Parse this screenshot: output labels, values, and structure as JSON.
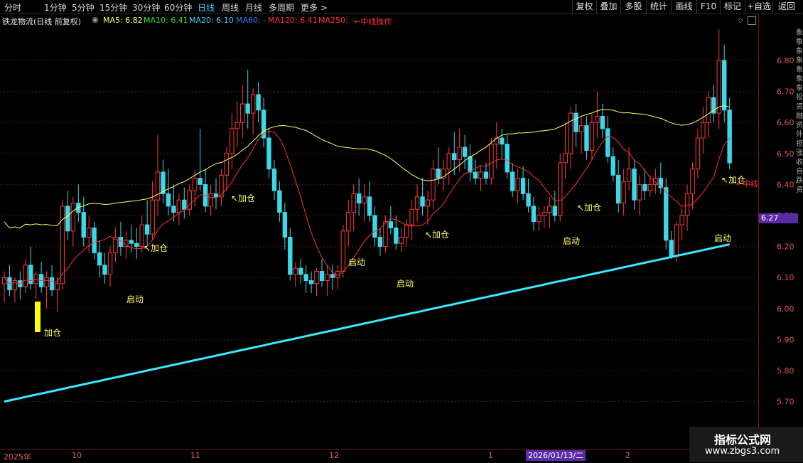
{
  "toolbar": {
    "periods": [
      "分时",
      "1分钟",
      "5分钟",
      "15分钟",
      "30分钟",
      "60分钟",
      "日线",
      "周线",
      "月线",
      "多周期",
      "更多 >"
    ],
    "active_period": "日线",
    "right_buttons": [
      "复权",
      "叠加",
      "多股",
      "统计",
      "画线",
      "F10",
      "标记",
      "+自选",
      "返回"
    ]
  },
  "info": {
    "stock_name": "铁龙物流(日线 前复权)",
    "ma5": "MA5: 6.82",
    "ma10": "MA10: 6.41",
    "ma20": "MA20: 6.10",
    "ma60": "MA60: -",
    "ma120": "MA120: 6.41",
    "ma250": "MA250:",
    "note": "←中线操作",
    "colors": {
      "ma5": "#ffff66",
      "ma10": "#33dd33",
      "ma20": "#3ad0ff",
      "ma60": "#3a7aff",
      "ma120": "#ff3333",
      "ma250": "#ff3333"
    }
  },
  "price_axis": {
    "ticks": [
      "6.80",
      "6.70",
      "6.60",
      "6.50",
      "6.40",
      "6.30",
      "6.20",
      "6.10",
      "6.00",
      "5.90",
      "5.80",
      "5.70"
    ],
    "current_price": "6.27"
  },
  "date_axis": {
    "labels": [
      "2025年",
      "10",
      "11",
      "12",
      "1",
      "2"
    ],
    "cursor_date": "2026/01/13/二"
  },
  "annotations": [
    {
      "text": "加仓"
    },
    {
      "text": "启动"
    },
    {
      "text": "↖加仓"
    },
    {
      "text": "↖加仓"
    },
    {
      "text": "启动"
    },
    {
      "text": "启动"
    },
    {
      "text": "↖加仓"
    },
    {
      "text": "↖加仓"
    },
    {
      "text": "启动"
    },
    {
      "text": "启动"
    },
    {
      "text": "↖加仓"
    },
    {
      "text": "←中线"
    }
  ],
  "watermark": {
    "line1": "指标公式网",
    "line2": "www.zbgs3.com"
  },
  "chart_data": {
    "type": "line",
    "title": "铁龙物流(日线 前复权)",
    "ylim": [
      5.65,
      6.92
    ],
    "candles": [
      [
        6.08,
        6.12,
        6.02,
        6.1
      ],
      [
        6.1,
        6.14,
        6.04,
        6.06
      ],
      [
        6.06,
        6.1,
        6.02,
        6.09
      ],
      [
        6.09,
        6.12,
        6.03,
        6.07
      ],
      [
        6.07,
        6.16,
        6.05,
        6.14
      ],
      [
        6.14,
        6.2,
        6.06,
        6.08
      ],
      [
        6.08,
        6.12,
        6.03,
        6.11
      ],
      [
        6.11,
        6.15,
        6.05,
        6.07
      ],
      [
        6.07,
        6.12,
        6.0,
        6.1
      ],
      [
        6.1,
        6.14,
        6.04,
        6.06
      ],
      [
        6.06,
        6.1,
        5.99,
        6.08
      ],
      [
        6.08,
        6.35,
        6.06,
        6.33
      ],
      [
        6.33,
        6.38,
        6.22,
        6.25
      ],
      [
        6.25,
        6.36,
        6.2,
        6.34
      ],
      [
        6.34,
        6.4,
        6.28,
        6.31
      ],
      [
        6.31,
        6.36,
        6.2,
        6.23
      ],
      [
        6.23,
        6.3,
        6.18,
        6.26
      ],
      [
        6.26,
        6.28,
        6.16,
        6.18
      ],
      [
        6.18,
        6.22,
        6.1,
        6.14
      ],
      [
        6.14,
        6.18,
        6.08,
        6.11
      ],
      [
        6.11,
        6.2,
        6.07,
        6.18
      ],
      [
        6.18,
        6.26,
        6.15,
        6.23
      ],
      [
        6.23,
        6.28,
        6.17,
        6.2
      ],
      [
        6.2,
        6.25,
        6.16,
        6.22
      ],
      [
        6.22,
        6.27,
        6.18,
        6.21
      ],
      [
        6.21,
        6.26,
        6.16,
        6.2
      ],
      [
        6.2,
        6.3,
        6.18,
        6.27
      ],
      [
        6.27,
        6.35,
        6.2,
        6.24
      ],
      [
        6.24,
        6.41,
        6.22,
        6.35
      ],
      [
        6.35,
        6.56,
        6.3,
        6.44
      ],
      [
        6.44,
        6.48,
        6.34,
        6.37
      ],
      [
        6.37,
        6.45,
        6.3,
        6.33
      ],
      [
        6.33,
        6.4,
        6.28,
        6.31
      ],
      [
        6.31,
        6.37,
        6.27,
        6.35
      ],
      [
        6.35,
        6.39,
        6.29,
        6.32
      ],
      [
        6.32,
        6.4,
        6.3,
        6.38
      ],
      [
        6.38,
        6.45,
        6.33,
        6.42
      ],
      [
        6.42,
        6.58,
        6.38,
        6.4
      ],
      [
        6.4,
        6.45,
        6.31,
        6.33
      ],
      [
        6.33,
        6.4,
        6.3,
        6.37
      ],
      [
        6.37,
        6.42,
        6.32,
        6.36
      ],
      [
        6.36,
        6.45,
        6.33,
        6.43
      ],
      [
        6.43,
        6.52,
        6.38,
        6.5
      ],
      [
        6.5,
        6.63,
        6.45,
        6.58
      ],
      [
        6.58,
        6.67,
        6.52,
        6.6
      ],
      [
        6.6,
        6.72,
        6.55,
        6.66
      ],
      [
        6.66,
        6.77,
        6.58,
        6.63
      ],
      [
        6.63,
        6.71,
        6.56,
        6.69
      ],
      [
        6.69,
        6.73,
        6.6,
        6.64
      ],
      [
        6.64,
        6.68,
        6.52,
        6.55
      ],
      [
        6.55,
        6.58,
        6.42,
        6.45
      ],
      [
        6.45,
        6.48,
        6.35,
        6.38
      ],
      [
        6.38,
        6.41,
        6.28,
        6.31
      ],
      [
        6.31,
        6.34,
        6.19,
        6.23
      ],
      [
        6.23,
        6.26,
        6.09,
        6.11
      ],
      [
        6.11,
        6.15,
        6.07,
        6.13
      ],
      [
        6.13,
        6.16,
        6.08,
        6.11
      ],
      [
        6.11,
        6.14,
        6.05,
        6.09
      ],
      [
        6.09,
        6.12,
        6.05,
        6.08
      ],
      [
        6.08,
        6.13,
        6.04,
        6.12
      ],
      [
        6.12,
        6.16,
        6.07,
        6.09
      ],
      [
        6.09,
        6.14,
        6.04,
        6.11
      ],
      [
        6.11,
        6.14,
        6.06,
        6.1
      ],
      [
        6.1,
        6.14,
        6.06,
        6.12
      ],
      [
        6.12,
        6.27,
        6.1,
        6.25
      ],
      [
        6.25,
        6.35,
        6.2,
        6.31
      ],
      [
        6.31,
        6.4,
        6.25,
        6.37
      ],
      [
        6.37,
        6.42,
        6.3,
        6.34
      ],
      [
        6.34,
        6.4,
        6.28,
        6.36
      ],
      [
        6.36,
        6.41,
        6.28,
        6.3
      ],
      [
        6.3,
        6.33,
        6.2,
        6.23
      ],
      [
        6.23,
        6.26,
        6.17,
        6.2
      ],
      [
        6.2,
        6.3,
        6.18,
        6.28
      ],
      [
        6.28,
        6.33,
        6.24,
        6.26
      ],
      [
        6.26,
        6.3,
        6.19,
        6.21
      ],
      [
        6.21,
        6.26,
        6.18,
        6.23
      ],
      [
        6.23,
        6.29,
        6.2,
        6.27
      ],
      [
        6.27,
        6.35,
        6.22,
        6.32
      ],
      [
        6.32,
        6.4,
        6.28,
        6.36
      ],
      [
        6.36,
        6.42,
        6.3,
        6.33
      ],
      [
        6.33,
        6.38,
        6.27,
        6.35
      ],
      [
        6.35,
        6.48,
        6.32,
        6.45
      ],
      [
        6.45,
        6.52,
        6.4,
        6.42
      ],
      [
        6.42,
        6.48,
        6.38,
        6.45
      ],
      [
        6.45,
        6.52,
        6.4,
        6.5
      ],
      [
        6.5,
        6.57,
        6.43,
        6.48
      ],
      [
        6.48,
        6.58,
        6.44,
        6.52
      ],
      [
        6.52,
        6.56,
        6.45,
        6.49
      ],
      [
        6.49,
        6.53,
        6.41,
        6.44
      ],
      [
        6.44,
        6.48,
        6.4,
        6.42
      ],
      [
        6.42,
        6.46,
        6.38,
        6.44
      ],
      [
        6.44,
        6.47,
        6.4,
        6.42
      ],
      [
        6.42,
        6.55,
        6.4,
        6.53
      ],
      [
        6.53,
        6.6,
        6.45,
        6.55
      ],
      [
        6.55,
        6.58,
        6.48,
        6.53
      ],
      [
        6.53,
        6.56,
        6.42,
        6.44
      ],
      [
        6.44,
        6.47,
        6.36,
        6.38
      ],
      [
        6.38,
        6.45,
        6.34,
        6.42
      ],
      [
        6.42,
        6.46,
        6.35,
        6.37
      ],
      [
        6.37,
        6.42,
        6.31,
        6.33
      ],
      [
        6.33,
        6.36,
        6.25,
        6.28
      ],
      [
        6.28,
        6.33,
        6.25,
        6.3
      ],
      [
        6.3,
        6.33,
        6.26,
        6.31
      ],
      [
        6.31,
        6.36,
        6.26,
        6.33
      ],
      [
        6.33,
        6.38,
        6.28,
        6.3
      ],
      [
        6.3,
        6.5,
        6.28,
        6.47
      ],
      [
        6.47,
        6.6,
        6.42,
        6.5
      ],
      [
        6.5,
        6.65,
        6.45,
        6.63
      ],
      [
        6.63,
        6.66,
        6.52,
        6.57
      ],
      [
        6.57,
        6.62,
        6.5,
        6.59
      ],
      [
        6.59,
        6.62,
        6.48,
        6.51
      ],
      [
        6.51,
        6.63,
        6.48,
        6.6
      ],
      [
        6.6,
        6.7,
        6.55,
        6.62
      ],
      [
        6.62,
        6.66,
        6.55,
        6.58
      ],
      [
        6.58,
        6.62,
        6.47,
        6.49
      ],
      [
        6.49,
        6.52,
        6.41,
        6.43
      ],
      [
        6.43,
        6.48,
        6.31,
        6.34
      ],
      [
        6.34,
        6.45,
        6.3,
        6.41
      ],
      [
        6.41,
        6.52,
        6.38,
        6.45
      ],
      [
        6.45,
        6.48,
        6.32,
        6.35
      ],
      [
        6.35,
        6.43,
        6.3,
        6.4
      ],
      [
        6.4,
        6.45,
        6.35,
        6.38
      ],
      [
        6.38,
        6.43,
        6.36,
        6.4
      ],
      [
        6.4,
        6.45,
        6.37,
        6.42
      ],
      [
        6.42,
        6.47,
        6.37,
        6.39
      ],
      [
        6.39,
        6.42,
        6.19,
        6.22
      ],
      [
        6.22,
        6.25,
        6.16,
        6.17
      ],
      [
        6.17,
        6.28,
        6.15,
        6.27
      ],
      [
        6.27,
        6.33,
        6.22,
        6.3
      ],
      [
        6.3,
        6.4,
        6.25,
        6.37
      ],
      [
        6.37,
        6.47,
        6.32,
        6.45
      ],
      [
        6.45,
        6.58,
        6.42,
        6.55
      ],
      [
        6.55,
        6.65,
        6.5,
        6.6
      ],
      [
        6.6,
        6.7,
        6.55,
        6.68
      ],
      [
        6.68,
        6.72,
        6.6,
        6.63
      ],
      [
        6.63,
        6.9,
        6.58,
        6.8
      ],
      [
        6.8,
        6.85,
        6.6,
        6.64
      ],
      [
        6.64,
        6.68,
        6.45,
        6.47
      ]
    ]
  }
}
